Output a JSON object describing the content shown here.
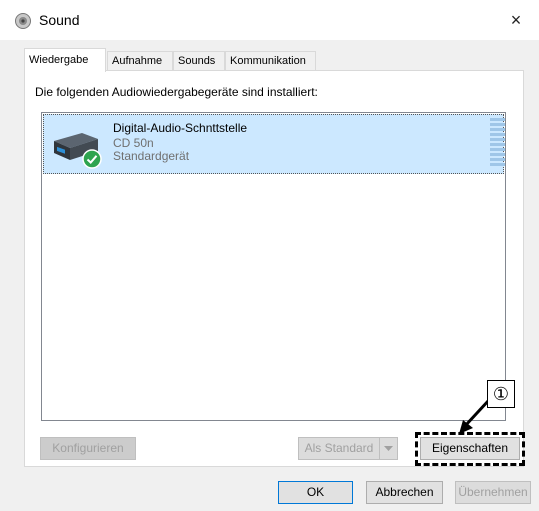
{
  "window": {
    "title": "Sound",
    "close_glyph": "×"
  },
  "tabs": [
    {
      "label": "Wiedergabe",
      "active": true
    },
    {
      "label": "Aufnahme",
      "active": false
    },
    {
      "label": "Sounds",
      "active": false
    },
    {
      "label": "Kommunikation",
      "active": false
    }
  ],
  "panel": {
    "heading": "Die folgenden Audiowiedergabegeräte sind installiert:"
  },
  "devices": [
    {
      "name": "Digital-Audio-Schnttstelle",
      "model": "CD 50n",
      "status": "Standardgerät",
      "selected": true,
      "status_icon": "check-icon"
    }
  ],
  "buttons": {
    "configure": "Konfigurieren",
    "set_default": "Als Standard",
    "properties": "Eigenschaften",
    "ok": "OK",
    "cancel": "Abbrechen",
    "apply": "Übernehmen"
  },
  "annotation": {
    "callout": "①"
  },
  "colors": {
    "selection": "#cce8ff",
    "accent": "#0078d7",
    "check": "#2ea44f"
  }
}
